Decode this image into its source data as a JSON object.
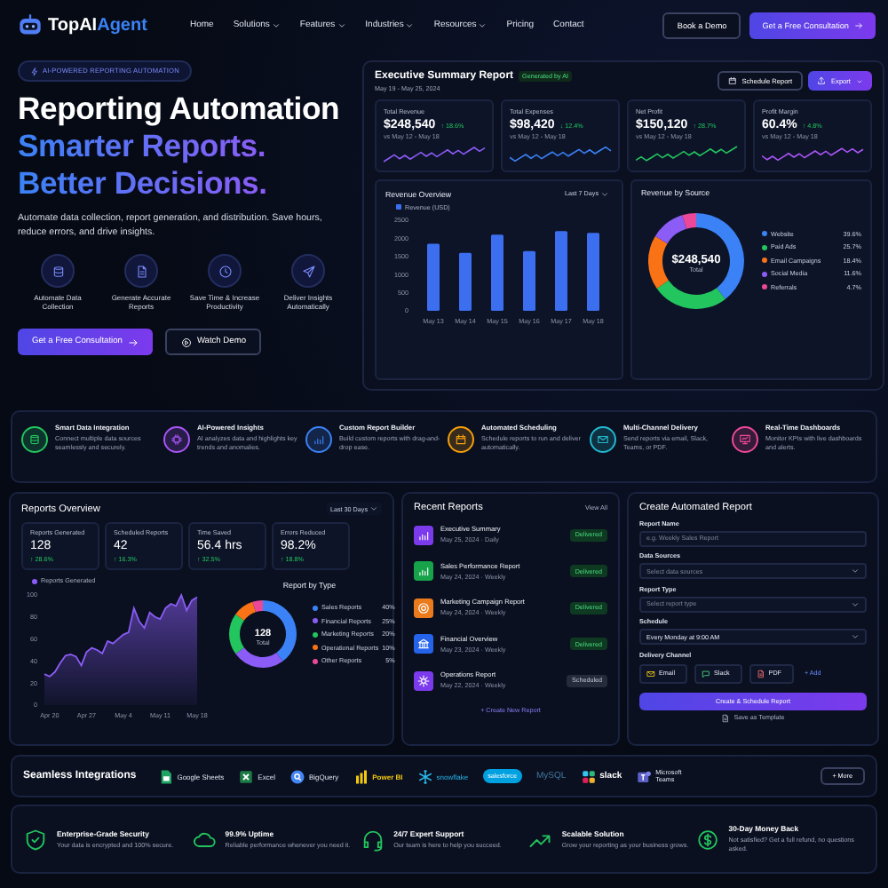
{
  "nav": {
    "logo": {
      "text": "TopAI",
      "accent": "Agent"
    },
    "links": [
      {
        "label": "Home",
        "dropdown": false
      },
      {
        "label": "Solutions",
        "dropdown": true
      },
      {
        "label": "Features",
        "dropdown": true
      },
      {
        "label": "Industries",
        "dropdown": true
      },
      {
        "label": "Resources",
        "dropdown": true
      },
      {
        "label": "Pricing",
        "dropdown": false
      },
      {
        "label": "Contact",
        "dropdown": false
      }
    ],
    "buttons": [
      {
        "label": "Book a Demo",
        "kind": "outline"
      },
      {
        "label": "Get a Free Consultation",
        "kind": "primary"
      }
    ]
  },
  "hero": {
    "badge": "AI-POWERED REPORTING AUTOMATION",
    "title": "Reporting Automation",
    "taglines": [
      "Smarter Reports.",
      "Better Decisions."
    ],
    "description": "Automate data collection, report generation, and distribution. Save hours, reduce errors, and drive insights.",
    "benefits": [
      {
        "label": "Automate Data Collection"
      },
      {
        "label": "Generate Accurate Reports"
      },
      {
        "label": "Save Time & Increase Productivity"
      },
      {
        "label": "Deliver Insights Automatically"
      }
    ],
    "buttons": [
      {
        "label": "Get a Free Consultation",
        "kind": "primary"
      },
      {
        "label": "Watch Demo",
        "kind": "outline"
      }
    ]
  },
  "dashboard": {
    "title": "Executive Summary Report",
    "badge": "Generated by AI",
    "date_range": "May 19 - May 25, 2024",
    "actions": [
      {
        "label": "Schedule Report",
        "kind": "outline"
      },
      {
        "label": "Export",
        "kind": "primary"
      }
    ],
    "kpis": [
      {
        "label": "Total Revenue",
        "value": "$248,540",
        "change": "↑ 18.6%",
        "period": "vs May 12 - May 18",
        "color": "#8b5cf6"
      },
      {
        "label": "Total Expenses",
        "value": "$98,420",
        "change": "↓ 12.4%",
        "period": "vs May 12 - May 18",
        "color": "#3b82f6"
      },
      {
        "label": "Net Profit",
        "value": "$150,120",
        "change": "↑ 28.7%",
        "period": "vs May 12 - May 18",
        "color": "#22c55e"
      },
      {
        "label": "Profit Margin",
        "value": "60.4%",
        "change": "↑ 4.8%",
        "period": "vs May 12 - May 18",
        "color": "#a855f7"
      }
    ],
    "revenue_overview": {
      "title": "Revenue Overview",
      "filter": "Last 7 Days",
      "chart_data": {
        "type": "bar",
        "categories": [
          "May 13",
          "May 14",
          "May 15",
          "May 16",
          "May 17",
          "May 18"
        ],
        "series": [
          {
            "name": "Revenue (USD)",
            "color": "#3b6ff0",
            "values": [
              1850,
              1600,
              2100,
              1650,
              2200,
              2150
            ]
          }
        ],
        "ylim": [
          0,
          2500
        ],
        "yticks": [
          0,
          500,
          1000,
          1500,
          2000,
          2500
        ]
      }
    },
    "revenue_by_source": {
      "title": "Revenue by Source",
      "total": "$248,540",
      "total_label": "Total",
      "chart_data": {
        "type": "donut",
        "categories": [
          "Website",
          "Paid Ads",
          "Email Campaigns",
          "Social Media",
          "Referrals"
        ],
        "values": [
          39.6,
          25.7,
          18.4,
          11.6,
          4.7
        ]
      },
      "legend": [
        {
          "share": "39.6%",
          "color": "#3b82f6"
        },
        {
          "share": "25.7%",
          "color": "#22c55e"
        },
        {
          "share": "18.4%",
          "color": "#f97316"
        },
        {
          "share": "11.6%",
          "color": "#8b5cf6"
        },
        {
          "share": "4.7%",
          "color": "#ec4899"
        }
      ]
    }
  },
  "features": [
    {
      "title": "Smart Data Integration",
      "text": "Connect multiple data sources seamlessly and securely.",
      "color": "#22c55e"
    },
    {
      "title": "AI-Powered Insights",
      "text": "AI analyzes data and highlights key trends and anomalies.",
      "color": "#a855f7"
    },
    {
      "title": "Custom Report Builder",
      "text": "Build custom reports with drag-and-drop ease.",
      "color": "#3b82f6"
    },
    {
      "title": "Automated Scheduling",
      "text": "Schedule reports to run and deliver automatically.",
      "color": "#f59e0b"
    },
    {
      "title": "Multi-Channel Delivery",
      "text": "Send reports via email, Slack, Teams, or PDF.",
      "color": "#22b8cf"
    },
    {
      "title": "Real-Time Dashboards",
      "text": "Monitor KPIs with live dashboards and alerts.",
      "color": "#ec4899"
    }
  ],
  "reports_overview": {
    "title": "Reports Overview",
    "filter": "Last 30 Days",
    "stats": [
      {
        "label": "Reports Generated",
        "value": "128",
        "change": "↑ 28.6%"
      },
      {
        "label": "Scheduled Reports",
        "value": "42",
        "change": "↑ 16.3%"
      },
      {
        "label": "Time Saved",
        "value": "56.4 hrs",
        "change": "↑ 32.5%"
      },
      {
        "label": "Errors Reduced",
        "value": "98.2%",
        "change": "↑ 18.8%"
      }
    ],
    "trend": {
      "chart_data": {
        "type": "area",
        "categories": [
          null,
          "Apr 20",
          null,
          null,
          null,
          null,
          null,
          null,
          "Apr 27",
          null,
          null,
          null,
          null,
          null,
          null,
          "May 4",
          null,
          null,
          null,
          null,
          null,
          null,
          "May 11",
          null,
          null,
          null,
          null,
          null,
          null,
          "May 18"
        ],
        "series": [
          {
            "name": "Reports Generated",
            "color": "#8b5cf6",
            "values": [
              28,
              26,
              30,
              38,
              45,
              46,
              44,
              36,
              48,
              52,
              50,
              47,
              58,
              56,
              60,
              64,
              66,
              88,
              76,
              70,
              84,
              80,
              78,
              88,
              92,
              90,
              100,
              86,
              95,
              98
            ]
          }
        ],
        "ylim": [
          0,
          100
        ],
        "yticks": [
          0,
          20,
          40,
          60,
          80,
          100
        ]
      }
    },
    "by_type": {
      "title": "Report by Type",
      "total": "128",
      "total_label": "Total",
      "chart_data": {
        "type": "donut",
        "categories": [
          "Sales Reports",
          "Financial Reports",
          "Marketing Reports",
          "Operational Reports",
          "Other Reports"
        ],
        "values": [
          40,
          25,
          20,
          10,
          5
        ]
      },
      "legend": [
        {
          "share": "40%",
          "color": "#3b82f6"
        },
        {
          "share": "25%",
          "color": "#8b5cf6"
        },
        {
          "share": "20%",
          "color": "#22c55e"
        },
        {
          "share": "10%",
          "color": "#f97316"
        },
        {
          "share": "5%",
          "color": "#ec4899"
        }
      ]
    }
  },
  "recent_reports": {
    "title": "Recent Reports",
    "link": "View All",
    "items": [
      {
        "name": "Executive Summary",
        "meta": "May 25, 2024 · Daily",
        "status": {
          "label": "Delivered",
          "kind": "delivered"
        },
        "color": "#7c3aed"
      },
      {
        "name": "Sales Performance Report",
        "meta": "May 24, 2024 · Weekly",
        "status": {
          "label": "Delivered",
          "kind": "delivered"
        },
        "color": "#16a34a"
      },
      {
        "name": "Marketing Campaign Report",
        "meta": "May 24, 2024 · Weekly",
        "status": {
          "label": "Delivered",
          "kind": "delivered"
        },
        "color": "#ea7a1c"
      },
      {
        "name": "Financial Overview",
        "meta": "May 23, 2024 · Weekly",
        "status": {
          "label": "Delivered",
          "kind": "delivered"
        },
        "color": "#2563eb"
      },
      {
        "name": "Operations Report",
        "meta": "May 22, 2024 · Weekly",
        "status": {
          "label": "Scheduled",
          "kind": "scheduled"
        },
        "color": "#7c3aed"
      }
    ],
    "create_link": "+ Create New Report"
  },
  "create_report": {
    "title": "Create Automated Report",
    "fields": [
      {
        "label": "Report Name",
        "kind": "text",
        "placeholder": "e.g. Weekly Sales Report"
      },
      {
        "label": "Data Sources",
        "kind": "select",
        "placeholder": "Select data sources"
      },
      {
        "label": "Report Type",
        "kind": "select",
        "placeholder": "Select report type"
      },
      {
        "label": "Schedule",
        "kind": "select",
        "value": "Every Monday at 9:00 AM"
      }
    ],
    "delivery": {
      "label": "Delivery Channel",
      "channels": [
        {
          "label": "Email"
        },
        {
          "label": "Slack"
        },
        {
          "label": "PDF"
        }
      ],
      "add": "+ Add"
    },
    "submit": "Create & Schedule Report",
    "secondary": "Save as Template"
  },
  "integrations": {
    "title": "Seamless Integrations",
    "items": [
      "Google Sheets",
      "Excel",
      "BigQuery",
      "Power BI",
      "snowflake",
      "salesforce",
      "MySQL",
      "slack",
      "Microsoft Teams"
    ],
    "more": "+ More"
  },
  "trust": [
    {
      "title": "Enterprise-Grade Security",
      "text": "Your data is encrypted and 100% secure."
    },
    {
      "title": "99.9% Uptime",
      "text": "Reliable performance whenever you need it."
    },
    {
      "title": "24/7 Expert Support",
      "text": "Our team is here to help you succeed."
    },
    {
      "title": "Scalable Solution",
      "text": "Grow your reporting as your business grows."
    },
    {
      "title": "30-Day Money Back",
      "text": "Not satisfied? Get a full refund, no questions asked."
    }
  ]
}
